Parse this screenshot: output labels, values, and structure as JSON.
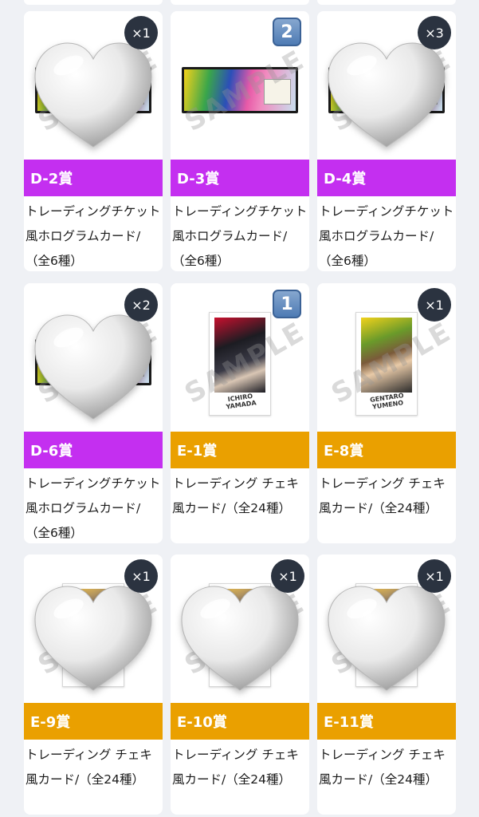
{
  "colors": {
    "d_prize": "#c42ff0",
    "e_prize": "#eaa000",
    "badge_bg": "#2b3340",
    "page_bg": "#eff1f5"
  },
  "watermark": "SAMPLE",
  "cards": [
    {
      "prize": "D-2賞",
      "description": "トレーディングチケット風ホログラムカード/（全6種）",
      "count": "×1",
      "image": "heart-sticker",
      "badge_style": "circle"
    },
    {
      "prize": "D-3賞",
      "description": "トレーディングチケット風ホログラムカード/（全6種）",
      "count": "2",
      "image": "ticket",
      "badge_style": "keycap"
    },
    {
      "prize": "D-4賞",
      "description": "トレーディングチケット風ホログラムカード/（全6種）",
      "count": "×3",
      "image": "heart-sticker",
      "badge_style": "circle"
    },
    {
      "prize": "D-6賞",
      "description": "トレーディングチケット風ホログラムカード/（全6種）",
      "count": "×2",
      "image": "heart-sticker",
      "badge_style": "circle"
    },
    {
      "prize": "E-1賞",
      "description": "トレーディング チェキ風カード/（全24種）",
      "count": "1",
      "image": "cheki-red",
      "badge_style": "keycap",
      "signature": "ICHIRO YAMADA"
    },
    {
      "prize": "E-8賞",
      "description": "トレーディング チェキ風カード/（全24種）",
      "count": "×1",
      "image": "cheki-yellow",
      "badge_style": "circle",
      "signature": "GENTARO YUMENO"
    },
    {
      "prize": "E-9賞",
      "description": "トレーディング チェキ風カード/（全24種）",
      "count": "×1",
      "image": "heart-sticker",
      "badge_style": "circle"
    },
    {
      "prize": "E-10賞",
      "description": "トレーディング チェキ風カード/（全24種）",
      "count": "×1",
      "image": "heart-sticker",
      "badge_style": "circle"
    },
    {
      "prize": "E-11賞",
      "description": "トレーディング チェキ風カード/（全24種）",
      "count": "×1",
      "image": "heart-sticker",
      "badge_style": "circle"
    }
  ]
}
